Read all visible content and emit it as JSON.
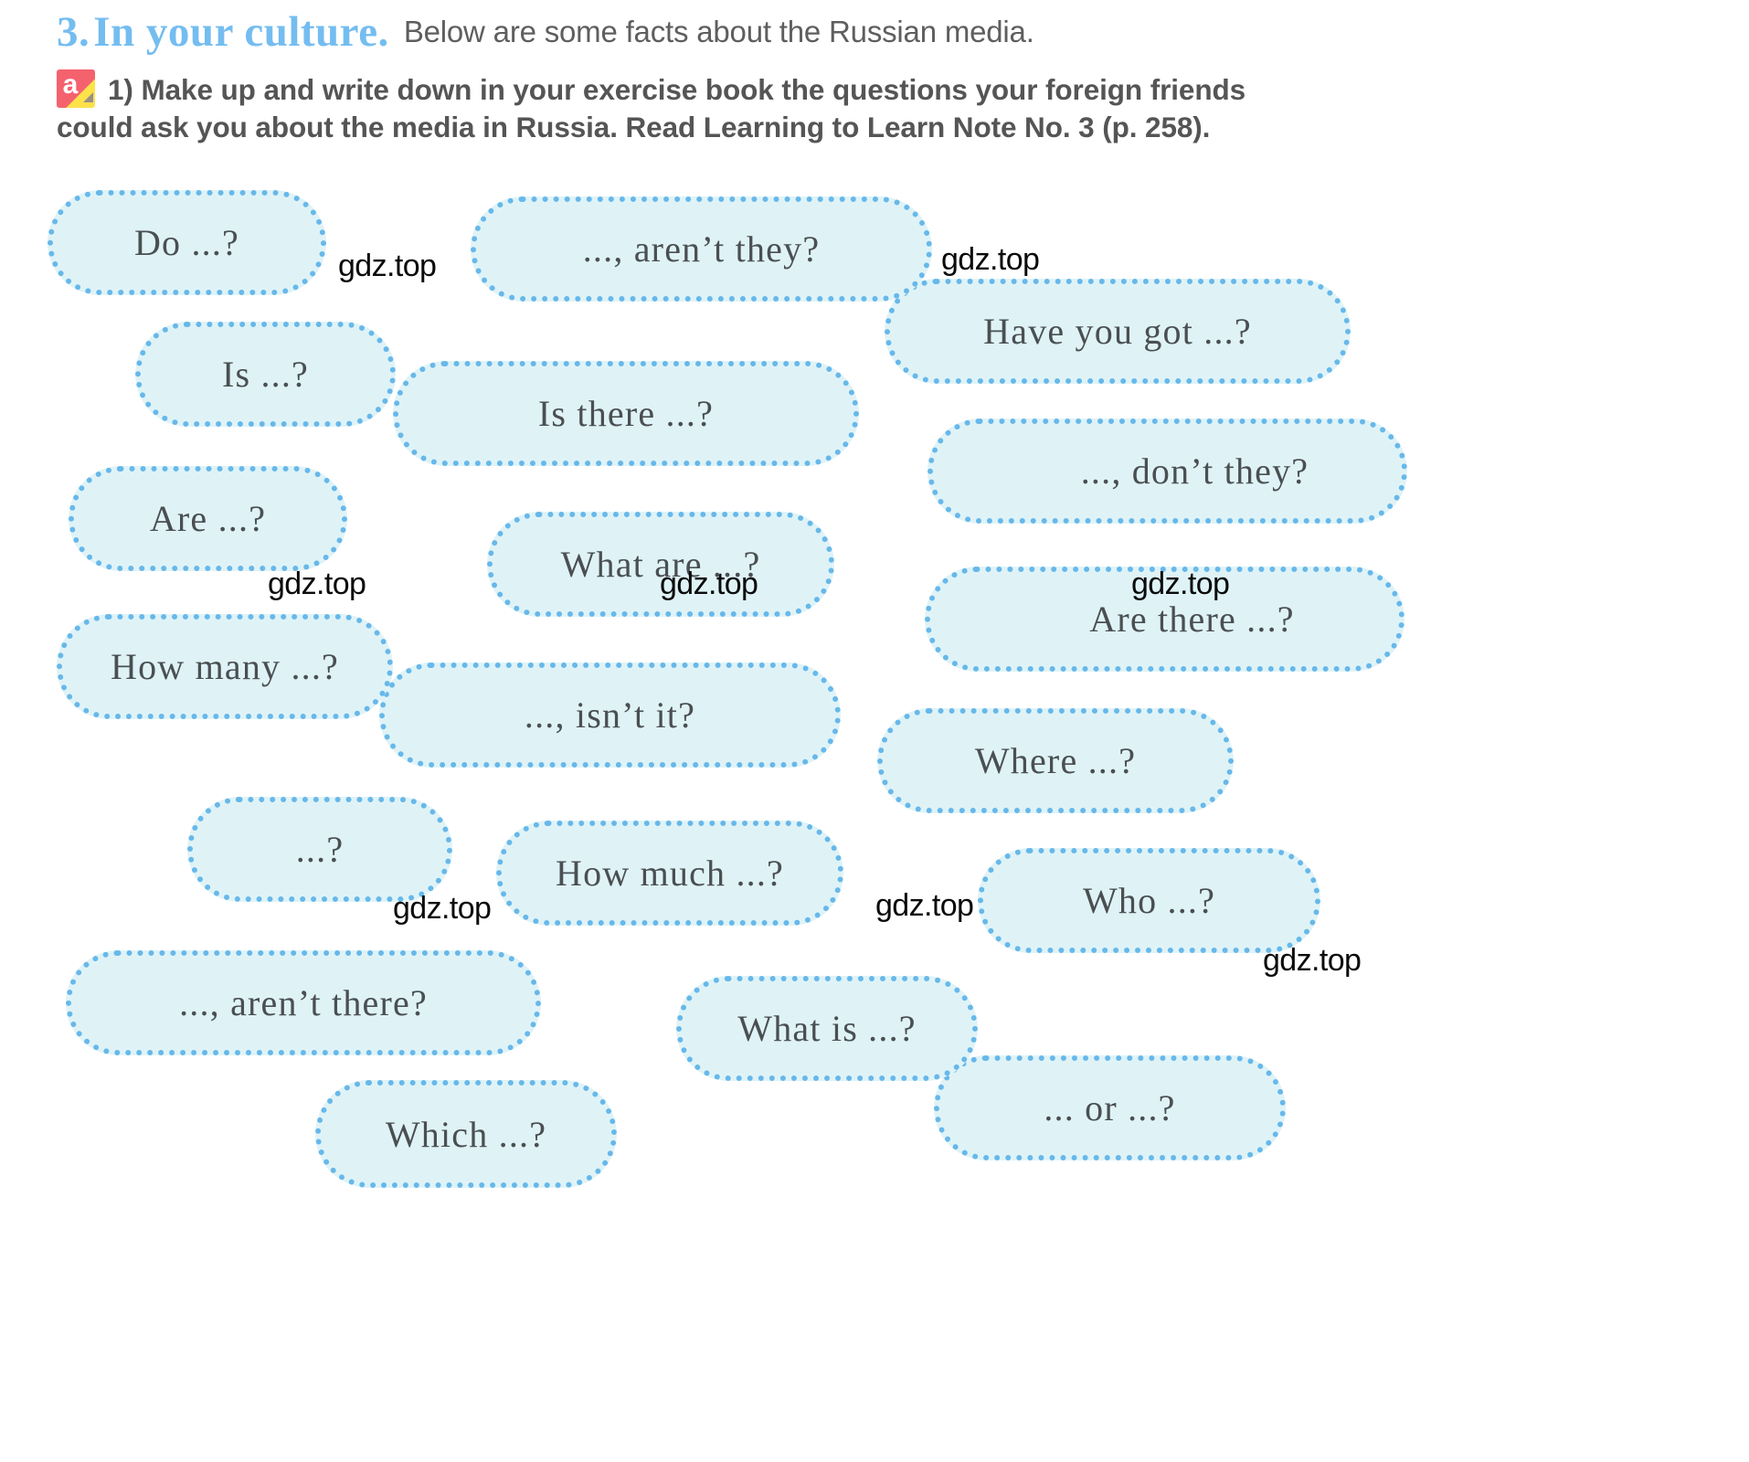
{
  "header": {
    "exercise_number": "3.",
    "title": "In your culture.",
    "subtitle": "Below are some facts about the Russian media.",
    "icon_name": "a-pencil-icon",
    "icon_letter": "a",
    "instruction_line1": "1) Make up and write down in your exercise book the questions your foreign friends",
    "instruction_line2": "could ask you about the media in Russia. Read Learning to Learn Note No. 3 (p. 258).",
    "title_color": "#74BDF0",
    "text_color": "#555555"
  },
  "bubbles": {
    "fill_color": "#dff3f7",
    "dot_color": "#67B8EA",
    "text_color": "#4a4f52",
    "items": [
      {
        "id": "do",
        "text": "Do ...?"
      },
      {
        "id": "arent-they",
        "text": "..., aren’t they?"
      },
      {
        "id": "have-you-got",
        "text": "Have you got ...?"
      },
      {
        "id": "is",
        "text": "Is ...?"
      },
      {
        "id": "is-there",
        "text": "Is there ...?"
      },
      {
        "id": "dont-they",
        "text": "..., don’t they?"
      },
      {
        "id": "are",
        "text": "Are ...?"
      },
      {
        "id": "what-are",
        "text": "What are ...?"
      },
      {
        "id": "are-there",
        "text": "Are there ...?"
      },
      {
        "id": "how-many",
        "text": "How many ...?"
      },
      {
        "id": "isnt-it",
        "text": "..., isn’t it?"
      },
      {
        "id": "where",
        "text": "Where ...?"
      },
      {
        "id": "ellipsis",
        "text": "...?"
      },
      {
        "id": "how-much",
        "text": "How much ...?"
      },
      {
        "id": "who",
        "text": "Who ...?"
      },
      {
        "id": "arent-there",
        "text": "..., aren’t there?"
      },
      {
        "id": "what-is",
        "text": "What is ...?"
      },
      {
        "id": "or",
        "text": "... or ...?"
      },
      {
        "id": "which",
        "text": "Which ...?"
      }
    ]
  },
  "watermarks": {
    "label": "gdz.top",
    "count": 8
  }
}
